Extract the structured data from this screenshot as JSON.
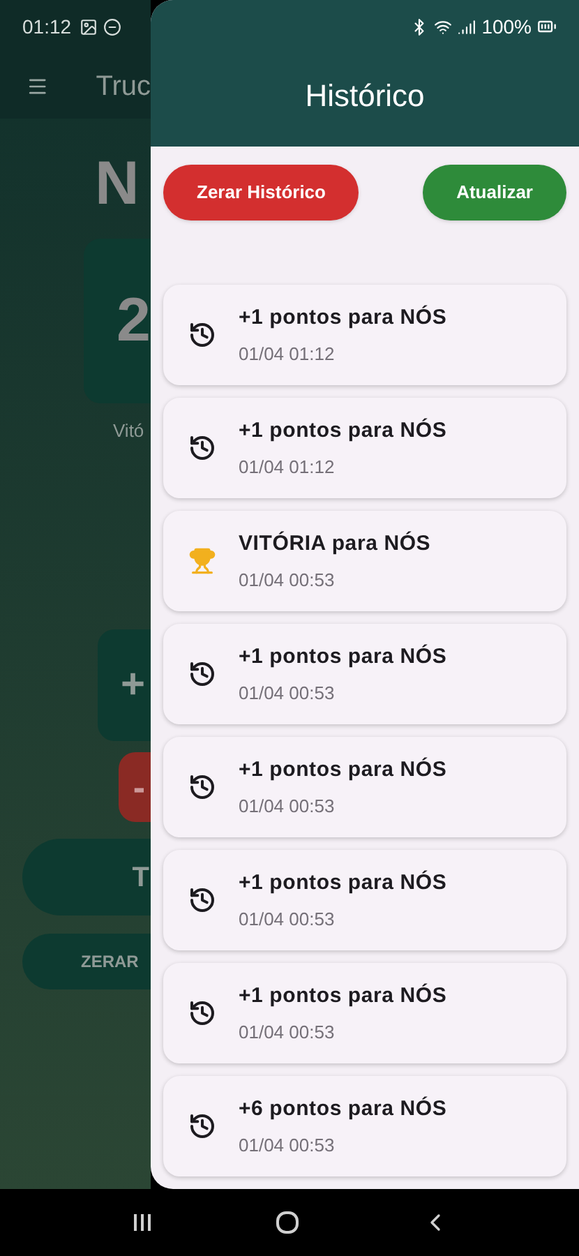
{
  "status_bar": {
    "time": "01:12",
    "battery": "100%"
  },
  "background": {
    "app_title": "Truc",
    "team": "N",
    "score": "2",
    "label": "Vitó",
    "plus": "+",
    "minus": "-",
    "button_1": "T",
    "reset": "ZERAR"
  },
  "drawer": {
    "title": "Histórico",
    "buttons": [
      {
        "label": "Zerar Histórico",
        "kind": "danger"
      },
      {
        "label": "Atualizar",
        "kind": "primary"
      }
    ],
    "entries": [
      {
        "kind": "points",
        "text": "+1 pontos para NÓS",
        "time": "01/04 01:12"
      },
      {
        "kind": "points",
        "text": "+1 pontos para NÓS",
        "time": "01/04 01:12"
      },
      {
        "kind": "victory",
        "text": "VITÓRIA para NÓS",
        "time": "01/04 00:53"
      },
      {
        "kind": "points",
        "text": "+1 pontos para NÓS",
        "time": "01/04 00:53"
      },
      {
        "kind": "points",
        "text": "+1 pontos para NÓS",
        "time": "01/04 00:53"
      },
      {
        "kind": "points",
        "text": "+1 pontos para NÓS",
        "time": "01/04 00:53"
      },
      {
        "kind": "points",
        "text": "+1 pontos para NÓS",
        "time": "01/04 00:53"
      },
      {
        "kind": "points",
        "text": "+6 pontos para NÓS",
        "time": "01/04 00:53"
      }
    ]
  }
}
